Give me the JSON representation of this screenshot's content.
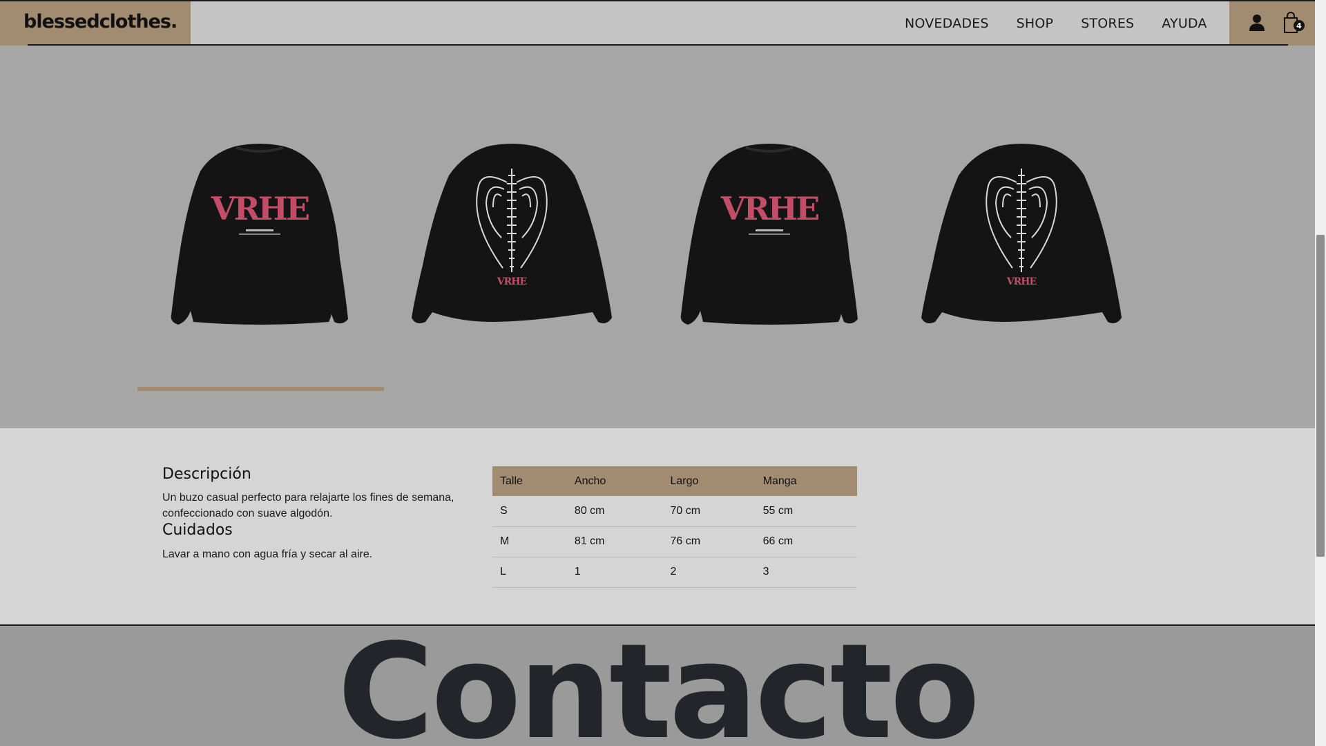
{
  "header": {
    "logo": "blessedclothes.",
    "nav": [
      "NOVEDADES",
      "SHOP",
      "STORES",
      "AYUDA"
    ],
    "cart_count": "4",
    "icons": {
      "user": "user-icon",
      "bag": "shopping-bag-icon"
    },
    "colors": {
      "accent": "#a18b71",
      "bar": "#c5c5c5"
    }
  },
  "gallery": {
    "images": [
      {
        "alt": "Buzo negro frente",
        "print": "VRHE",
        "print_color": "#c24d67",
        "view": "front"
      },
      {
        "alt": "Buzo negro espalda",
        "print": "wings-spine",
        "print_color": "#d9d9d9",
        "view": "back"
      },
      {
        "alt": "Buzo negro frente",
        "print": "VRHE",
        "print_color": "#c24d67",
        "view": "front"
      },
      {
        "alt": "Buzo negro espalda",
        "print": "wings-spine",
        "print_color": "#d9d9d9",
        "view": "back"
      }
    ],
    "slide_progress": 0.25
  },
  "details": {
    "description_title": "Descripción",
    "description_line1": "Un buzo casual perfecto para relajarte los fines de semana,",
    "description_line2": "confeccionado con suave algodón.",
    "care_title": "Cuidados",
    "care_text": "Lavar a mano con agua fría y secar al aire.",
    "size_table": {
      "headers": [
        "Talle",
        "Ancho",
        "Largo",
        "Manga"
      ],
      "rows": [
        [
          "S",
          "80 cm",
          "70 cm",
          "55 cm"
        ],
        [
          "M",
          "81 cm",
          "76 cm",
          "66 cm"
        ],
        [
          "L",
          "1",
          "2",
          "3"
        ]
      ]
    }
  },
  "contact": {
    "title": "Contacto"
  }
}
